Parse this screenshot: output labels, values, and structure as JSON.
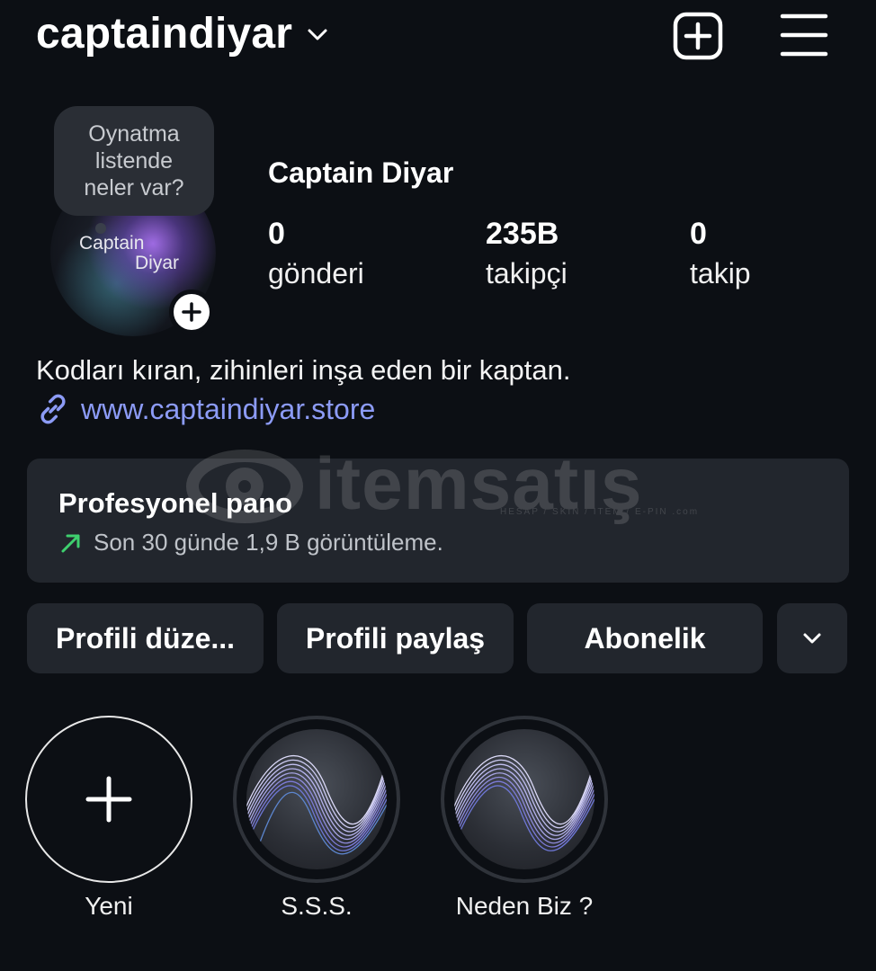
{
  "header": {
    "username": "captaindiyar",
    "add_icon": "plus-square-icon",
    "menu_icon": "hamburger-menu-icon"
  },
  "profile": {
    "note_lines": [
      "Oynatma",
      "listende",
      "neler var?"
    ],
    "avatar_text": [
      "Captain",
      "Diyar"
    ],
    "display_name": "Captain Diyar",
    "stats": [
      {
        "value": "0",
        "label": "gönderi"
      },
      {
        "value": "235B",
        "label": "takipçi"
      },
      {
        "value": "0",
        "label": "takip"
      }
    ],
    "bio": "Kodları kıran, zihinleri inşa eden bir kaptan.",
    "link": "www.captaindiyar.store"
  },
  "watermark": {
    "text": "itemsatış",
    "sub": "HESAP / SKIN / ITEM / E-PIN .com"
  },
  "dashboard": {
    "title": "Profesyonel pano",
    "subtitle": "Son 30 günde 1,9 B görüntüleme.",
    "trend_color": "#3ecf6e"
  },
  "buttons": {
    "edit": "Profili düze...",
    "share": "Profili paylaş",
    "subscription": "Abonelik"
  },
  "highlights": [
    {
      "label": "Yeni"
    },
    {
      "label": "S.S.S."
    },
    {
      "label": "Neden Biz ?"
    }
  ],
  "colors": {
    "background": "#0c0f14",
    "surface": "#22262d",
    "link": "#8c9bf6"
  }
}
